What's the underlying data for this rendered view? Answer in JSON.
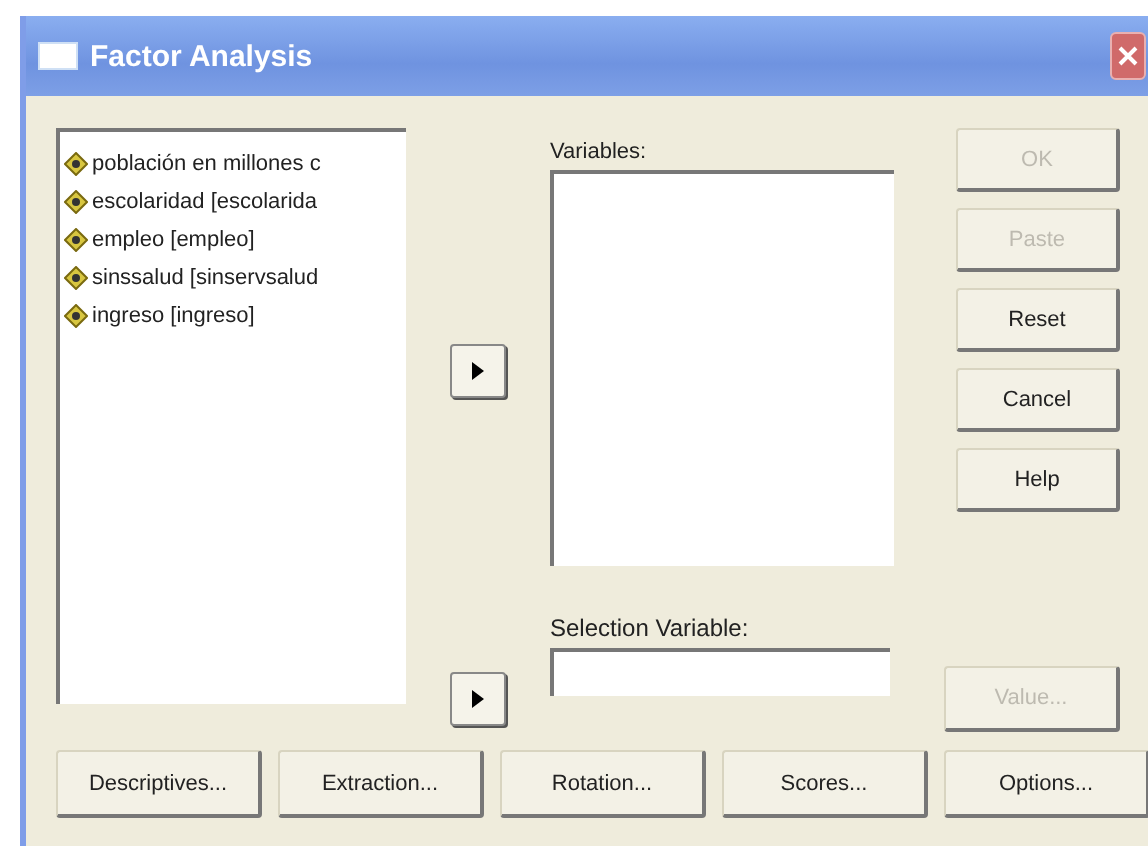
{
  "window": {
    "title": "Factor Analysis"
  },
  "source_variables": [
    "población en millones c",
    "escolaridad [escolarida",
    "empleo [empleo]",
    "sinssalud [sinservsalud",
    "ingreso [ingreso]"
  ],
  "variables": {
    "label": "Variables:"
  },
  "selection_variable": {
    "label": "Selection Variable:"
  },
  "side_buttons": [
    {
      "label": "OK",
      "disabled": true
    },
    {
      "label": "Paste",
      "disabled": true
    },
    {
      "label": "Reset",
      "disabled": false
    },
    {
      "label": "Cancel",
      "disabled": false
    },
    {
      "label": "Help",
      "disabled": false
    }
  ],
  "value_button": {
    "label": "Value...",
    "disabled": true
  },
  "bottom_buttons": [
    "Descriptives...",
    "Extraction...",
    "Rotation...",
    "Scores...",
    "Options..."
  ]
}
